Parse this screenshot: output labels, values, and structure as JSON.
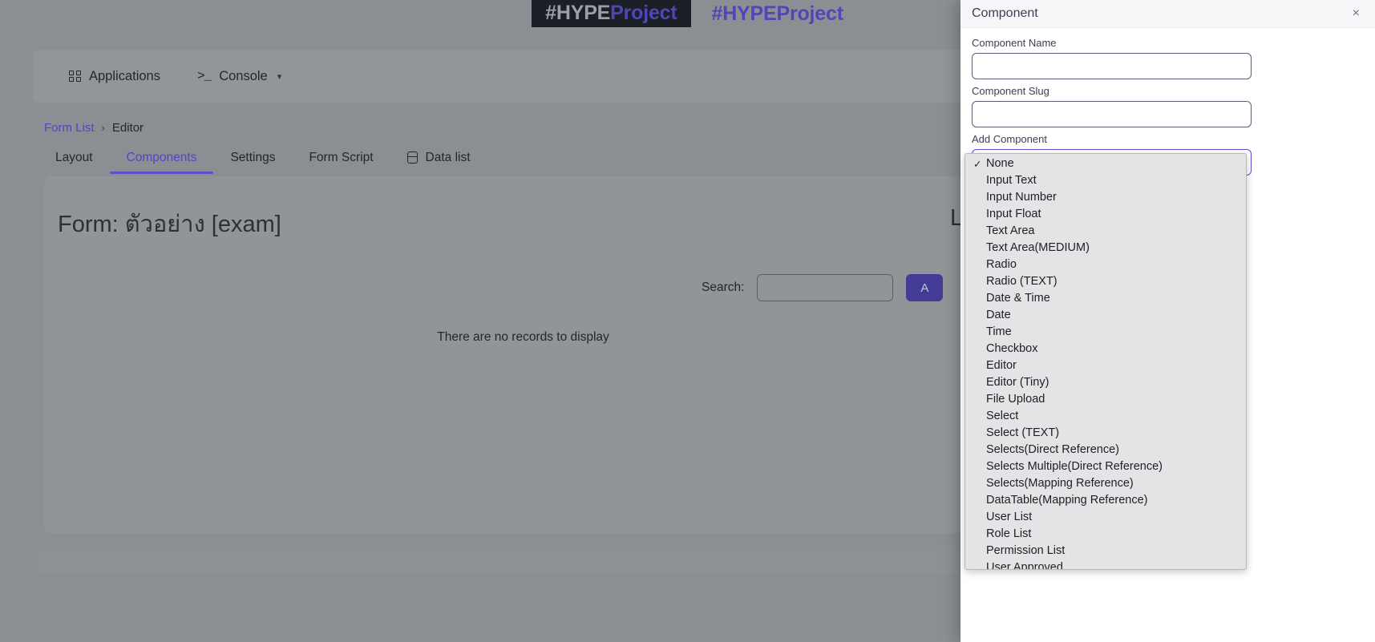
{
  "brand": {
    "chip_primary": "#HYPE",
    "chip_accent": "Project",
    "plain": "#HYPEProject",
    "accent_color": "#4f46b8"
  },
  "topnav": {
    "applications_label": "Applications",
    "console_label": "Console",
    "console_icon": ">_",
    "caret": "⌄"
  },
  "breadcrumb": {
    "root": "Form List",
    "separator": "›",
    "current": "Editor"
  },
  "tabs": [
    {
      "label": "Layout",
      "active": false
    },
    {
      "label": "Components",
      "active": true
    },
    {
      "label": "Settings",
      "active": false
    },
    {
      "label": "Form Script",
      "active": false
    },
    {
      "label": "Data list",
      "active": false,
      "icon": "database-icon"
    }
  ],
  "main": {
    "form_title": "Form: ตัวอย่าง [exam]",
    "layout_title": "Layo",
    "search_label": "Search:",
    "search_value": "",
    "search_placeholder": "",
    "add_button_label": "A",
    "empty_message": "There are no records to display"
  },
  "modal": {
    "title": "Component",
    "close_icon": "×",
    "component_name_label": "Component Name",
    "component_name_value": "",
    "component_slug_label": "Component Slug",
    "component_slug_value": "",
    "add_component_label": "Add Component",
    "selected_option": "None",
    "options": [
      {
        "label": "None",
        "selected": true
      },
      {
        "label": "Input Text",
        "selected": false
      },
      {
        "label": "Input Number",
        "selected": false
      },
      {
        "label": "Input Float",
        "selected": false
      },
      {
        "label": "Text Area",
        "selected": false
      },
      {
        "label": "Text Area(MEDIUM)",
        "selected": false
      },
      {
        "label": "Radio",
        "selected": false
      },
      {
        "label": "Radio (TEXT)",
        "selected": false
      },
      {
        "label": "Date & Time",
        "selected": false
      },
      {
        "label": "Date",
        "selected": false
      },
      {
        "label": "Time",
        "selected": false
      },
      {
        "label": "Checkbox",
        "selected": false
      },
      {
        "label": "Editor",
        "selected": false
      },
      {
        "label": "Editor (Tiny)",
        "selected": false
      },
      {
        "label": "File Upload",
        "selected": false
      },
      {
        "label": "Select",
        "selected": false
      },
      {
        "label": "Select (TEXT)",
        "selected": false
      },
      {
        "label": "Selects(Direct Reference)",
        "selected": false
      },
      {
        "label": "Selects Multiple(Direct Reference)",
        "selected": false
      },
      {
        "label": "Selects(Mapping Reference)",
        "selected": false
      },
      {
        "label": "DataTable(Mapping Reference)",
        "selected": false
      },
      {
        "label": "User List",
        "selected": false
      },
      {
        "label": "Role List",
        "selected": false
      },
      {
        "label": "Permission List",
        "selected": false
      },
      {
        "label": "User Approved",
        "selected": false
      }
    ]
  },
  "colors": {
    "accent_purple": "#5b52c9",
    "link_purple": "#4e46c6",
    "button_purple": "#423c96",
    "page_dim": "#8b8f93"
  }
}
